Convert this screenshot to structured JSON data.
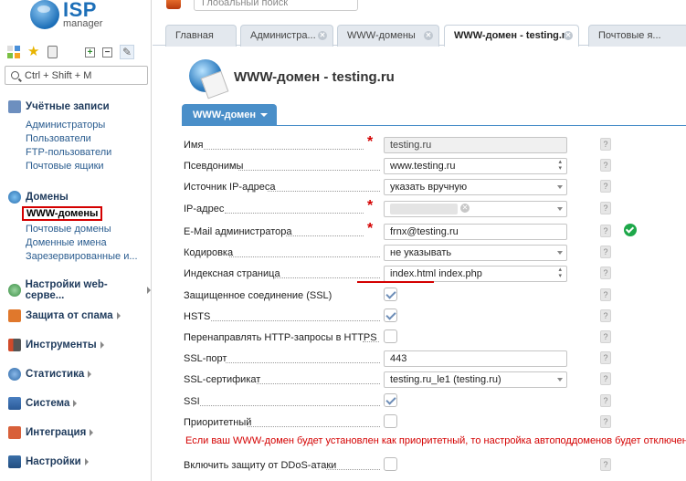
{
  "logo": {
    "brand": "ISP",
    "product": "manager"
  },
  "sidebar": {
    "search_placeholder": "Ctrl + Shift + M",
    "sections": [
      {
        "label": "Учётные записи",
        "icon": "users-icon",
        "expanded": true,
        "items": [
          "Администраторы",
          "Пользователи",
          "FTP-пользователи",
          "Почтовые ящики"
        ]
      },
      {
        "label": "Домены",
        "icon": "globe-icon",
        "expanded": true,
        "items": [
          "WWW-домены",
          "Почтовые домены",
          "Доменные имена",
          "Зарезервированные и..."
        ]
      },
      {
        "label": "Настройки web-серве...",
        "icon": "web-settings-icon",
        "expanded": false
      },
      {
        "label": "Защита от спама",
        "icon": "spam-shield-icon",
        "expanded": false
      },
      {
        "label": "Инструменты",
        "icon": "tools-icon",
        "expanded": false
      },
      {
        "label": "Статистика",
        "icon": "stats-icon",
        "expanded": false
      },
      {
        "label": "Система",
        "icon": "system-icon",
        "expanded": false
      },
      {
        "label": "Интеграция",
        "icon": "integration-icon",
        "expanded": false
      },
      {
        "label": "Настройки",
        "icon": "settings-icon",
        "expanded": false
      }
    ],
    "active_item": "WWW-домены"
  },
  "topbar": {
    "search_placeholder": "Глобальный поиск"
  },
  "tabs": [
    {
      "label": "Главная",
      "closable": false,
      "active": false
    },
    {
      "label": "Администра...",
      "closable": true,
      "active": false
    },
    {
      "label": "WWW-домены",
      "closable": true,
      "active": false
    },
    {
      "label": "WWW-домен - testing.ru",
      "closable": true,
      "active": true
    },
    {
      "label": "Почтовые я...",
      "closable": false,
      "active": false
    }
  ],
  "page": {
    "title": "WWW-домен - testing.ru",
    "subtab": "WWW-домен"
  },
  "form": {
    "fields": [
      {
        "label": "Имя",
        "required": true,
        "type": "readonly",
        "value": "testing.ru"
      },
      {
        "label": "Псевдонимы",
        "required": false,
        "type": "spin",
        "value": "www.testing.ru"
      },
      {
        "label": "Источник IP-адреса",
        "required": false,
        "type": "select",
        "value": "указать вручную"
      },
      {
        "label": "IP-адрес",
        "required": true,
        "type": "chip",
        "value": ""
      },
      {
        "label": "E-Mail администратора",
        "required": true,
        "type": "text",
        "value": "frnx@testing.ru",
        "valid": true
      },
      {
        "label": "Кодировка",
        "required": false,
        "type": "select",
        "value": "не указывать"
      },
      {
        "label": "Индексная страница",
        "required": false,
        "type": "spin",
        "value": "index.html index.php"
      },
      {
        "label": "Защищенное соединение (SSL)",
        "required": false,
        "type": "checkbox",
        "checked": true
      },
      {
        "label": "HSTS",
        "required": false,
        "type": "checkbox",
        "checked": true
      },
      {
        "label": "Перенаправлять HTTP-запросы в HTTPS",
        "required": false,
        "type": "checkbox",
        "checked": false
      },
      {
        "label": "SSL-порт",
        "required": false,
        "type": "text",
        "value": "443"
      },
      {
        "label": "SSL-сертификат",
        "required": false,
        "type": "select",
        "value": "testing.ru_le1 (testing.ru)"
      },
      {
        "label": "SSI",
        "required": false,
        "type": "checkbox",
        "checked": true
      },
      {
        "label": "Приоритетный",
        "required": false,
        "type": "checkbox",
        "checked": false
      },
      {
        "label": "Включить защиту от DDoS-атаки",
        "required": false,
        "type": "checkbox",
        "checked": false
      }
    ],
    "warning": "Если ваш WWW-домен будет установлен как приоритетный, то настройка автоподдоменов будет отключена",
    "help_glyph": "?"
  },
  "colors": {
    "accent": "#4a8fc9",
    "required": "#d40000",
    "ok": "#1ea84a"
  }
}
